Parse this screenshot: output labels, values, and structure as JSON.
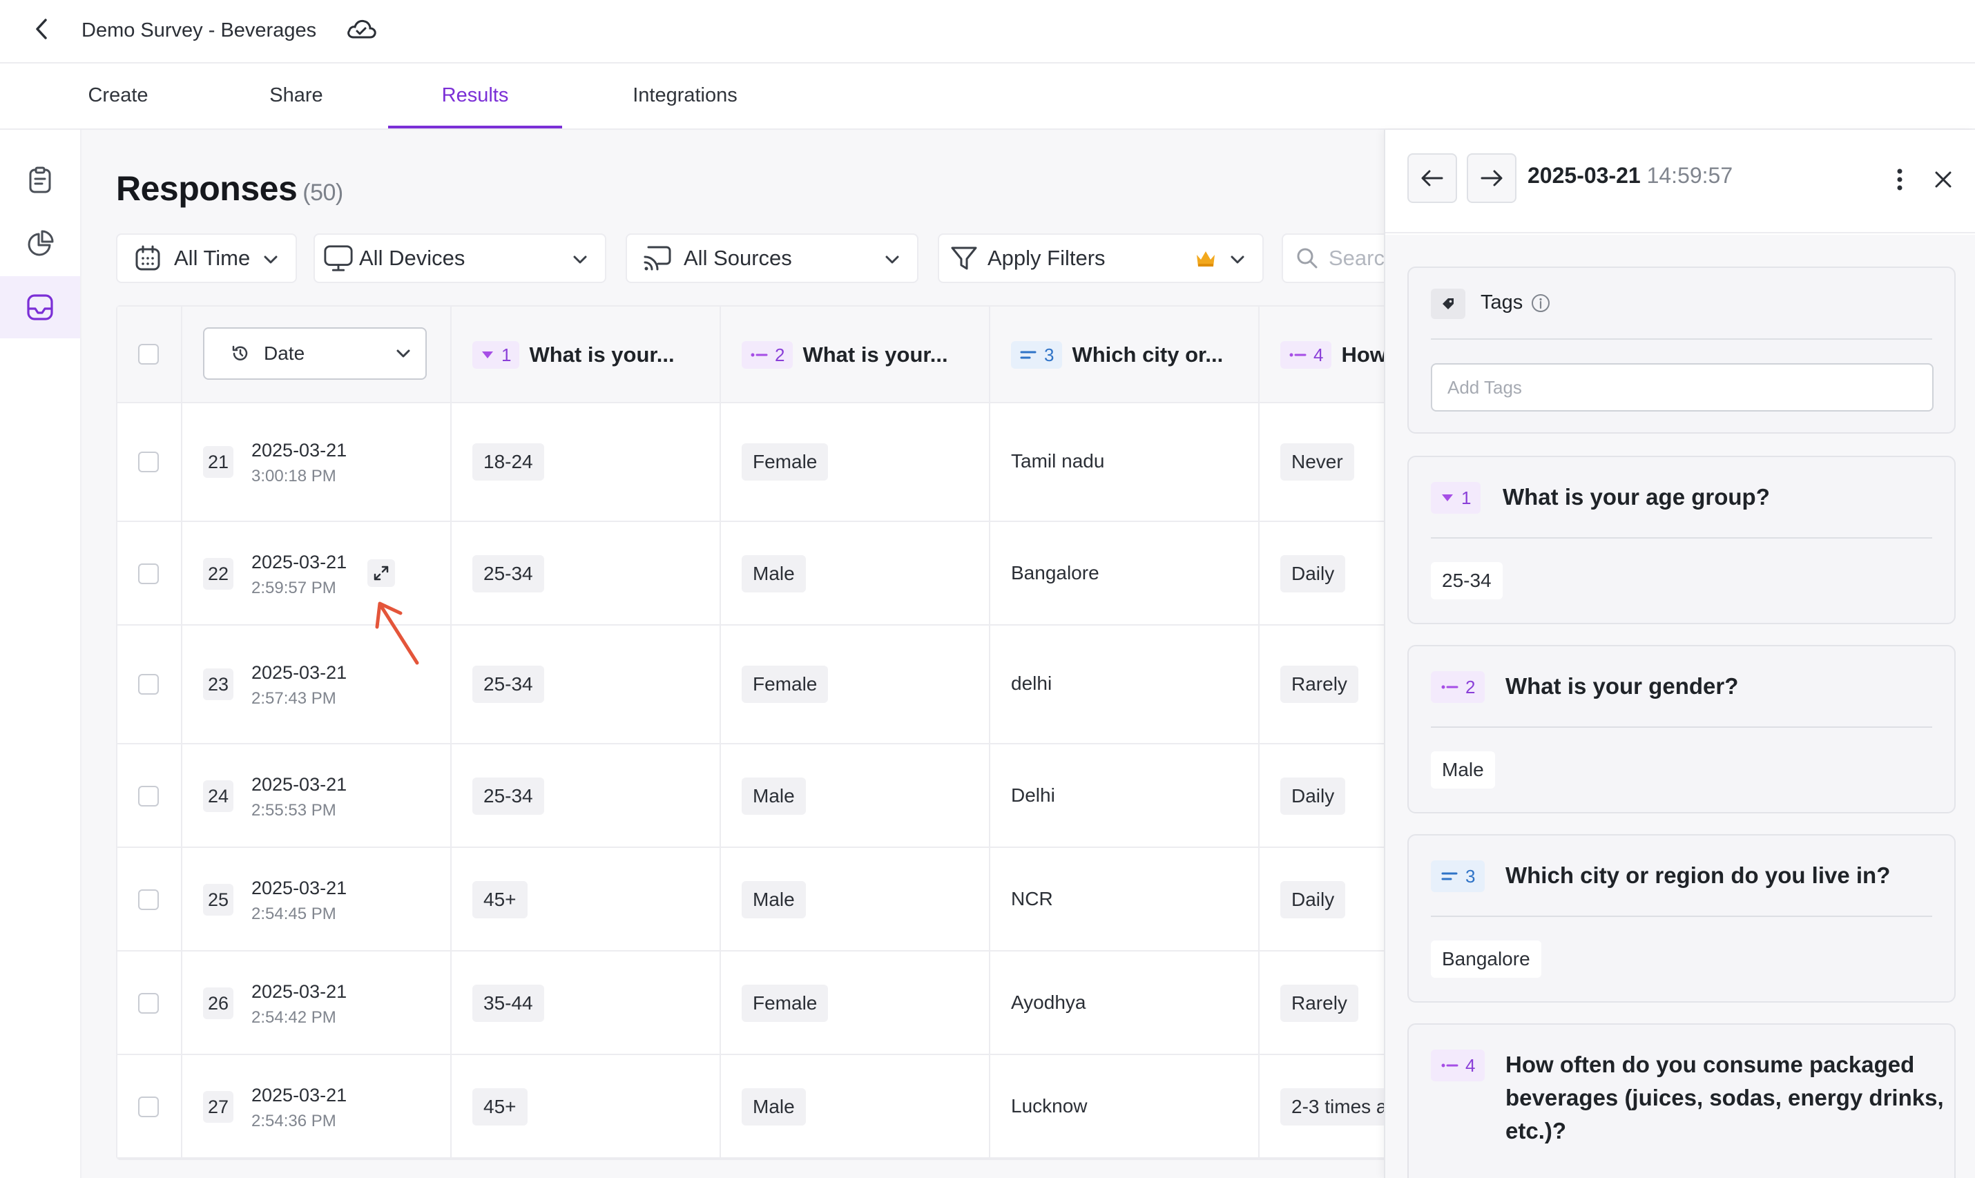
{
  "app": {
    "title": "Demo Survey - Beverages"
  },
  "tabs": [
    {
      "label": "Create"
    },
    {
      "label": "Share"
    },
    {
      "label": "Results"
    },
    {
      "label": "Integrations"
    }
  ],
  "main": {
    "title": "Responses",
    "count": "(50)",
    "filters": {
      "time": "All Time",
      "devices": "All Devices",
      "sources": "All Sources",
      "apply": "Apply Filters",
      "search_placeholder": "Search"
    }
  },
  "table": {
    "date_label": "Date",
    "columns": [
      {
        "num": "1",
        "label": "What is your..."
      },
      {
        "num": "2",
        "label": "What is your..."
      },
      {
        "num": "3",
        "label": "Which city or..."
      },
      {
        "num": "4",
        "label": "How"
      }
    ],
    "rows": [
      {
        "num": "21",
        "date": "2025-03-21",
        "time": "3:00:18 PM",
        "age": "18-24",
        "gender": "Female",
        "city": "Tamil nadu",
        "freq": "Never"
      },
      {
        "num": "22",
        "date": "2025-03-21",
        "time": "2:59:57 PM",
        "age": "25-34",
        "gender": "Male",
        "city": "Bangalore",
        "freq": "Daily"
      },
      {
        "num": "23",
        "date": "2025-03-21",
        "time": "2:57:43 PM",
        "age": "25-34",
        "gender": "Female",
        "city": "delhi",
        "freq": "Rarely"
      },
      {
        "num": "24",
        "date": "2025-03-21",
        "time": "2:55:53 PM",
        "age": "25-34",
        "gender": "Male",
        "city": "Delhi",
        "freq": "Daily"
      },
      {
        "num": "25",
        "date": "2025-03-21",
        "time": "2:54:45 PM",
        "age": "45+",
        "gender": "Male",
        "city": "NCR",
        "freq": "Daily"
      },
      {
        "num": "26",
        "date": "2025-03-21",
        "time": "2:54:42 PM",
        "age": "35-44",
        "gender": "Female",
        "city": "Ayodhya",
        "freq": "Rarely"
      },
      {
        "num": "27",
        "date": "2025-03-21",
        "time": "2:54:36 PM",
        "age": "45+",
        "gender": "Male",
        "city": "Lucknow",
        "freq": "2-3 times a"
      }
    ]
  },
  "panel": {
    "date": "2025-03-21",
    "time": "14:59:57",
    "tags_label": "Tags",
    "tags_placeholder": "Add Tags",
    "questions": [
      {
        "num": "1",
        "title": "What is your age group?",
        "answer": "25-34"
      },
      {
        "num": "2",
        "title": "What is your gender?",
        "answer": "Male"
      },
      {
        "num": "3",
        "title": "Which city or region do you live in?",
        "answer": "Bangalore"
      },
      {
        "num": "4",
        "title_line1": "How often do you consume packaged",
        "title_line2": "beverages (juices, sodas, energy drinks,",
        "title_line3": "etc.)?"
      }
    ]
  },
  "colors": {
    "accent": "#7b2fd6",
    "annotation": "#e4553a",
    "crown": "#f2a81d"
  }
}
